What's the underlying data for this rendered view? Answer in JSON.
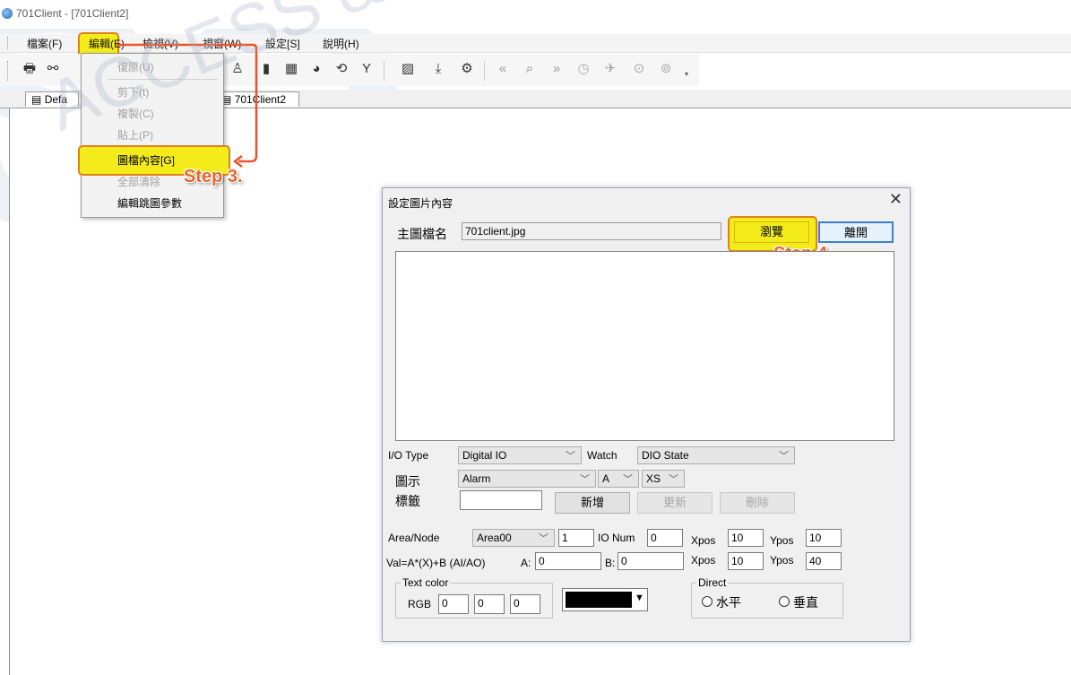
{
  "window": {
    "title": "701Client - [701Client2]"
  },
  "menubar": [
    "檔案(F)",
    "編輯(E)",
    "檢視(V)",
    "視窗(W)",
    "設定[S]",
    "說明(H)"
  ],
  "edit_menu": {
    "undo": "復原(U)",
    "cut": "剪下(t)",
    "copy": "複製(C)",
    "paste": "貼上(P)",
    "image_content": "圖檔內容[G]",
    "clear_all": "全部清除",
    "edit_jump": "編輯跳圖參數"
  },
  "tabs": {
    "default": "Defa",
    "client2": "701Client2"
  },
  "steps": {
    "step3": "Step 3.",
    "step4": "Step 4."
  },
  "dialog": {
    "title": "設定圖片內容",
    "main_file_label": "主圖檔名",
    "main_file_value": "701client.jpg",
    "browse": "瀏覽",
    "leave": "離開",
    "io_type_label": "I/O Type",
    "io_type_value": "Digital IO",
    "watch_label": "Watch",
    "watch_value": "DIO State",
    "icon_label": "圖示",
    "icon_value": "Alarm",
    "icon_a_value": "A",
    "icon_size_value": "XS",
    "tag_label": "標籤",
    "tag_value": "",
    "add": "新增",
    "update": "更新",
    "delete": "刪除",
    "area_node_label": "Area/Node",
    "area_value": "Area00",
    "node_value": "1",
    "io_num_label": "IO Num",
    "io_num_value": "0",
    "xpos_label": "Xpos",
    "xpos1_value": "10",
    "ypos_label": "Ypos",
    "ypos1_value": "10",
    "val_formula_label": "Val=A*(X)+B (AI/AO)",
    "a_label": "A:",
    "a_value": "0",
    "b_label": "B:",
    "b_value": "0",
    "xpos2_value": "10",
    "ypos2_value": "40",
    "text_color_label": "Text color",
    "rgb_label": "RGB",
    "r_value": "0",
    "g_value": "0",
    "b_rgb_value": "0",
    "direct_label": "Direct",
    "horizontal": "水平",
    "vertical": "垂直"
  },
  "colors": {
    "highlight": "#f4ec1a",
    "step_text": "#e8662a",
    "swatch": "#000000"
  },
  "watermark": {
    "line1": "ACCESS & INDUSTRIAL CO"
  }
}
